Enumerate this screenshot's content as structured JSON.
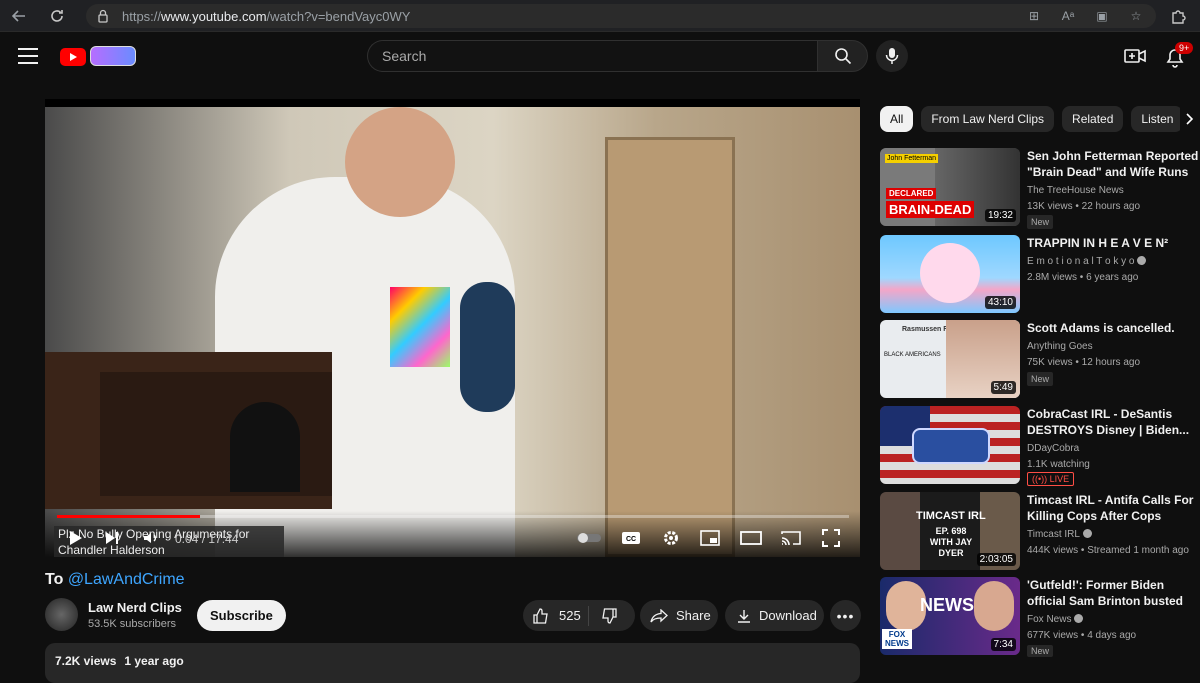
{
  "browser": {
    "url_prefix": "https://",
    "url_domain": "www.youtube.com",
    "url_path": "/watch?v=bendVayc0WY"
  },
  "header": {
    "search_placeholder": "Search",
    "notification_count": "9+"
  },
  "video": {
    "pip_title": "Plz No Bully Opening Arguments for Chandler Halderson",
    "time_display": "0:04 / 17:44"
  },
  "meta": {
    "title_prefix": "To",
    "title_tag": "@LawAndCrime",
    "channel_name": "Law Nerd Clips",
    "subscribers": "53.5K subscribers",
    "subscribe_label": "Subscribe",
    "likes": "525",
    "share_label": "Share",
    "download_label": "Download",
    "views": "7.2K views",
    "age": "1 year ago"
  },
  "chips": [
    "All",
    "From Law Nerd Clips",
    "Related",
    "Listen"
  ],
  "recommendations": [
    {
      "title": "Sen John Fetterman Reported \"Brain Dead\" and Wife Runs T...",
      "channel": "The TreeHouse News",
      "meta": "13K views • 22 hours ago",
      "badge": "New",
      "duration": "19:32",
      "thumb_text": "BRAIN-DEAD",
      "thumb_sub": "DECLARED",
      "thumb_top": "John Fetterman"
    },
    {
      "title": "TRAPPIN IN H E A V E N²",
      "channel": "E m o t i o n a l T o k y o",
      "meta": "2.8M views • 6 years ago",
      "duration": "43:10"
    },
    {
      "title": "Scott Adams is cancelled.",
      "channel": "Anything Goes",
      "meta": "75K views • 12 hours ago",
      "badge": "New",
      "duration": "5:49",
      "thumb_text": "Rasmussen Reports",
      "thumb_sub": "BLACK AMERICANS"
    },
    {
      "title": "CobraCast IRL - DeSantis DESTROYS Disney | Biden...",
      "channel": "DDayCobra",
      "meta": "1.1K watching",
      "live_label": "LIVE"
    },
    {
      "title": "Timcast IRL - Antifa Calls For Killing Cops After Cops Kills...",
      "channel": "Timcast IRL",
      "meta": "444K views • Streamed 1 month ago",
      "duration": "2:03:05",
      "thumb_text": "TIMCAST IRL",
      "thumb_sub": "EP. 698 WITH JAY DYER"
    },
    {
      "title": "'Gutfeld!': Former Biden official Sam Brinton busted once again",
      "channel": "Fox News",
      "meta": "677K views • 4 days ago",
      "badge": "New",
      "duration": "7:34",
      "thumb_text": "NEWS",
      "thumb_sub": "FOX NEWS"
    }
  ],
  "colors": {
    "accent": "#3ea6ff",
    "brand": "#ff0000",
    "live": "#ff4e45"
  }
}
